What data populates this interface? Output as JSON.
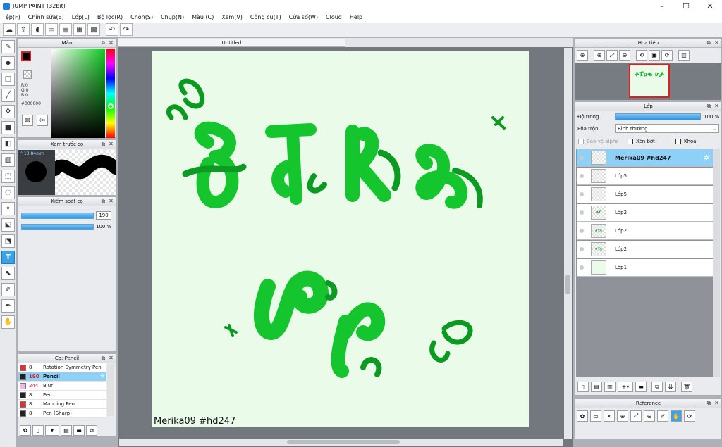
{
  "window": {
    "title": "JUMP PAINT (32bit)",
    "minimize": "–",
    "maximize": "☐",
    "close": "✕"
  },
  "menu": [
    "Tệp(F)",
    "Chỉnh sửa(E)",
    "Lớp(L)",
    "Bộ lọc(R)",
    "Chọn(S)",
    "Chụp(N)",
    "Màu (C)",
    "Xem(V)",
    "Công cụ(T)",
    "Cửa sổ(W)",
    "Cloud",
    "Help"
  ],
  "color_panel": {
    "title": "Màu",
    "r": "R:0",
    "g": "G:0",
    "b": "B:0",
    "hex": "#000000",
    "current_color": "#000000",
    "accent": "#e02020"
  },
  "preview_panel": {
    "title": "Xem trước cọ",
    "size": "° 13.84mm"
  },
  "brush_control": {
    "title": "Kiểm soát cọ",
    "size_value": "190",
    "opacity_value": "100 %"
  },
  "brush_list": {
    "title": "Cọ: Pencil",
    "items": [
      {
        "size": "8",
        "name": "Rotation Symmetry Pen",
        "color": "#e03030"
      },
      {
        "size": "190",
        "name": "Pencil",
        "color": "#222222"
      },
      {
        "size": "244",
        "name": "Blur",
        "color": "#f4b6f0"
      },
      {
        "size": "8",
        "name": "Pen",
        "color": "#222222"
      },
      {
        "size": "8",
        "name": "Mapping Pen",
        "color": "#e03030"
      },
      {
        "size": "8",
        "name": "Pen (Sharp)",
        "color": "#222222"
      }
    ]
  },
  "canvas": {
    "tab": "Untitled",
    "signature": "Merika09  #hd247",
    "paper_color": "#eafbea",
    "stroke_color": "#12c42a"
  },
  "navigator": {
    "title": "Hoa tiêu",
    "thumb_text": "ቆፔኳቈ ሆቇ"
  },
  "layer_panel": {
    "title": "Lớp",
    "opacity_label": "Độ trong",
    "opacity_value": "100 %",
    "blend_label": "Pha trộn",
    "blend_value": "Bình thường",
    "protect_alpha": "Bảo vệ alpha",
    "clip": "Xén bớt",
    "lock": "Khóa",
    "layers": [
      {
        "name": "Merika09  #hd247",
        "thumb": ""
      },
      {
        "name": "Lớp5",
        "thumb": ""
      },
      {
        "name": "Lớp5",
        "thumb": ""
      },
      {
        "name": "Lớp2",
        "thumb": "ቆፔ"
      },
      {
        "name": "Lớp2",
        "thumb": "ቆፔኳ"
      },
      {
        "name": "Lớp2",
        "thumb": "ቆፔኳ"
      },
      {
        "name": "Lớp1",
        "thumb": ""
      }
    ]
  },
  "reference": {
    "title": "Reference"
  }
}
